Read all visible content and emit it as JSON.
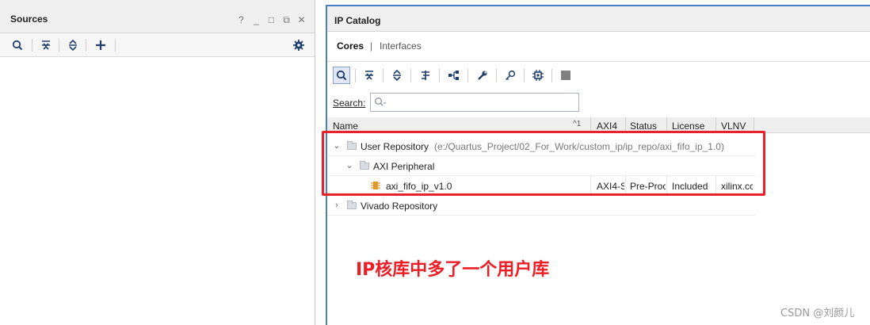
{
  "sources": {
    "title": "Sources",
    "window_controls": [
      "?",
      "_",
      "□",
      "⧉",
      "✕"
    ],
    "toolbar_icons": [
      "search-icon",
      "collapse-all-icon",
      "expand-all-icon",
      "add-icon",
      "gear-icon"
    ]
  },
  "ip_catalog": {
    "title": "IP Catalog",
    "tabs": {
      "cores": "Cores",
      "divider": "|",
      "interfaces": "Interfaces"
    },
    "search": {
      "label": "Search:",
      "value": "",
      "placeholder": ""
    },
    "columns": {
      "name": "Name",
      "sort_indicator": "^1",
      "axi4": "AXI4",
      "status": "Status",
      "license": "License",
      "vlnv": "VLNV"
    },
    "rows": {
      "user_repo": {
        "name": "User Repository",
        "path": "(e:/Quartus_Project/02_For_Work/custom_ip/ip_repo/axi_fifo_ip_1.0)"
      },
      "axi_peripheral": {
        "name": "AXI Peripheral"
      },
      "ip": {
        "name": "axi_fifo_ip_v1.0",
        "axi4": "AXI4-S",
        "status": "Pre-Proc",
        "license": "Included",
        "vlnv": "xilinx.cc"
      },
      "vivado_repo": {
        "name": "Vivado Repository"
      }
    }
  },
  "annotation": {
    "text": "IP核库中多了一个用户库"
  },
  "watermark": {
    "text": "CSDN @刘颜儿"
  },
  "colors": {
    "accent": "#4a7fc1",
    "highlight": "#e8222a",
    "annotation": "#ee1c25",
    "icon": "#1e3f6e"
  }
}
